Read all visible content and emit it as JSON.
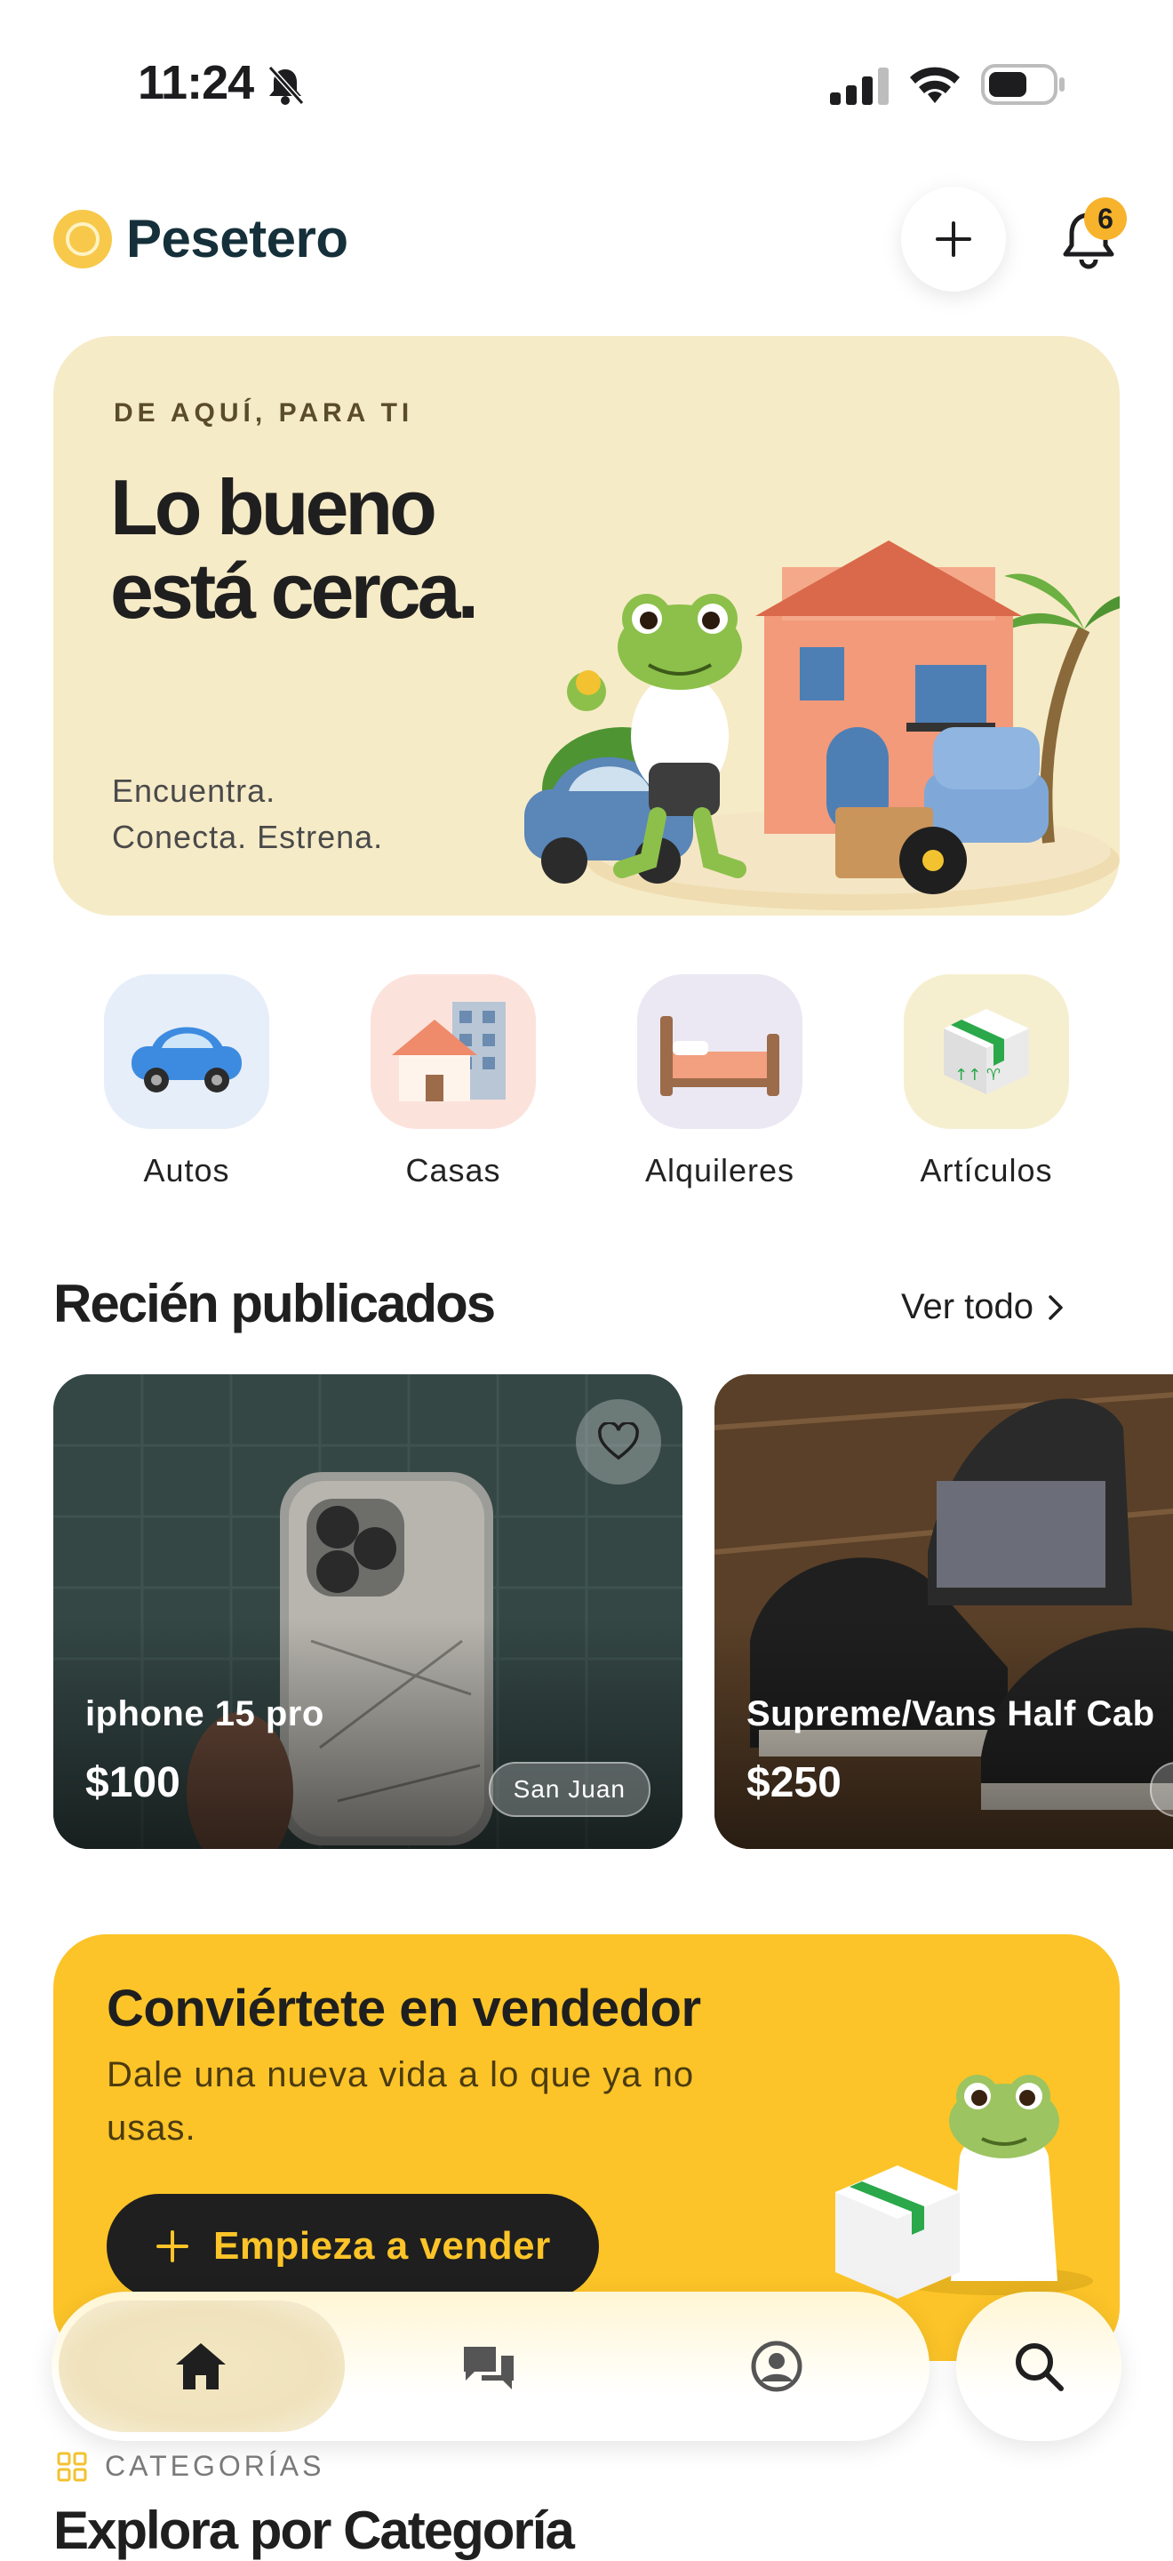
{
  "status_bar": {
    "time": "11:24"
  },
  "header": {
    "brand": "Pesetero",
    "notification_count": "6"
  },
  "hero": {
    "kicker": "DE AQUÍ, PARA TI",
    "title_line1": "Lo bueno",
    "title_line2": "está cerca.",
    "sub_line1": "Encuentra.",
    "sub_line2": "Conecta. Estrena."
  },
  "categories": [
    {
      "label": "Autos",
      "bg": "#e6eef9"
    },
    {
      "label": "Casas",
      "bg": "#fbe3dc"
    },
    {
      "label": "Alquileres",
      "bg": "#ece8f3"
    },
    {
      "label": "Artículos",
      "bg": "#f6efcf"
    }
  ],
  "recent": {
    "title": "Recién publicados",
    "see_all": "Ver todo",
    "items": [
      {
        "title": "iphone 15 pro",
        "price": "$100",
        "location": "San Juan"
      },
      {
        "title": "Supreme/Vans Half Cab",
        "price": "$250",
        "location": ""
      }
    ]
  },
  "seller": {
    "title": "Conviértete en vendedor",
    "subtitle": "Dale una nueva vida a lo que ya no usas.",
    "button": "Empieza a vender"
  },
  "nav": {
    "items": [
      {
        "icon": "home-icon"
      },
      {
        "icon": "chat-icon"
      },
      {
        "icon": "profile-icon"
      },
      {
        "icon": "search-icon"
      }
    ]
  },
  "categories_section": {
    "kicker": "CATEGORÍAS",
    "title": "Explora por Categoría"
  },
  "colors": {
    "accent": "#fcc428",
    "hero_bg": "#f6ebc7",
    "dark": "#1f1f1f"
  }
}
